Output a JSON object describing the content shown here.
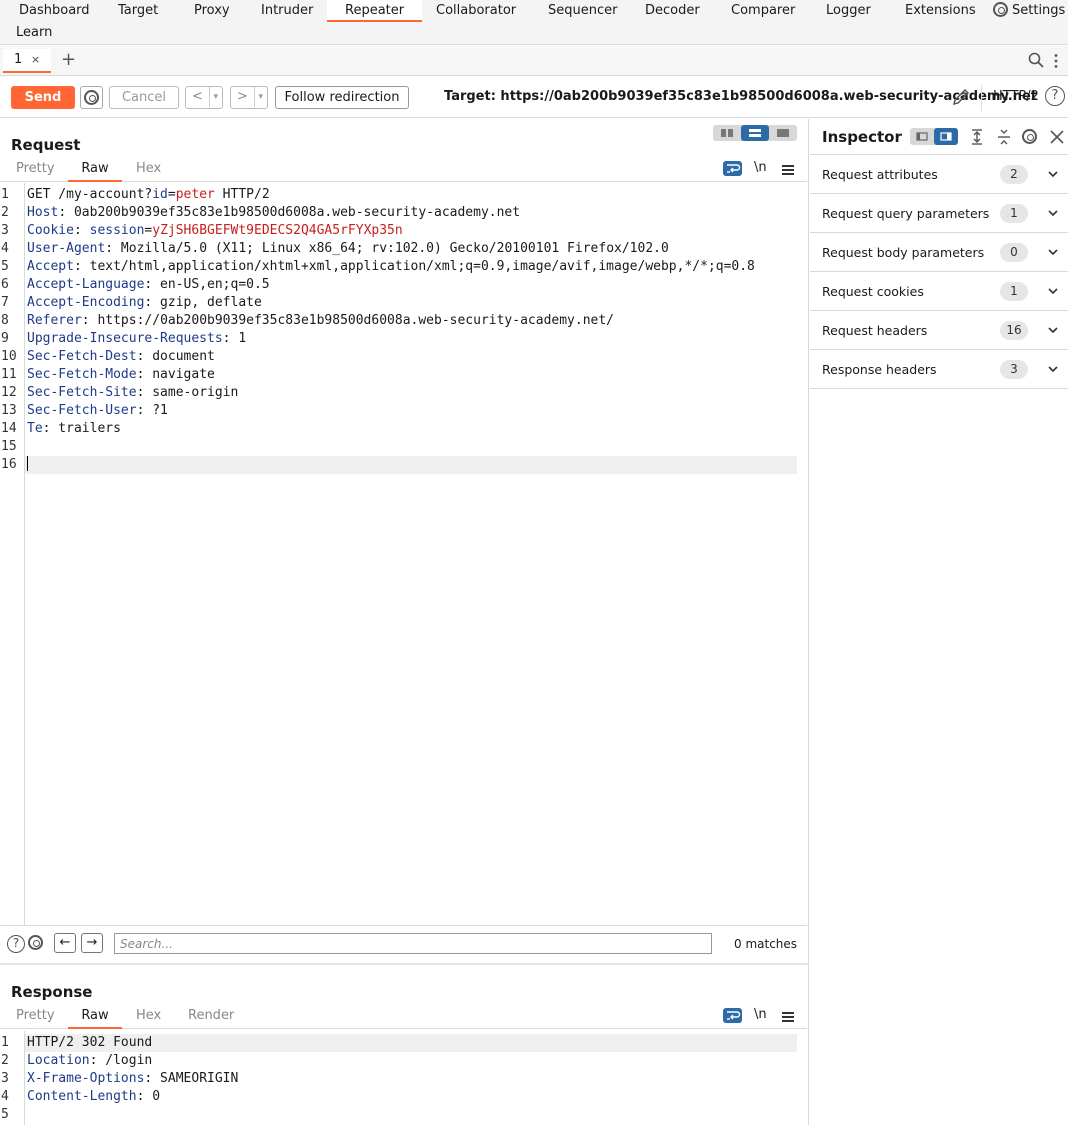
{
  "menu": {
    "items": [
      "Dashboard",
      "Target",
      "Proxy",
      "Intruder",
      "Repeater",
      "Collaborator",
      "Sequencer",
      "Decoder",
      "Comparer",
      "Logger",
      "Extensions"
    ],
    "settings": "Settings",
    "learn": "Learn",
    "active": "Repeater"
  },
  "tabs": {
    "items": [
      {
        "label": "1",
        "close": "×"
      }
    ],
    "add": "+"
  },
  "toolbar": {
    "send": "Send",
    "cancel": "Cancel",
    "back": "<",
    "forward": ">",
    "dropdown": "▾",
    "follow": "Follow redirection",
    "target": "Target: https://0ab200b9039ef35c83e1b98500d6008a.web-security-academy.net",
    "protocol": "HTTP/2",
    "help": "?"
  },
  "request": {
    "title": "Request",
    "subtabs": [
      "Pretty",
      "Raw",
      "Hex"
    ],
    "active_subtab": "Raw",
    "newline_toggle": "\\n",
    "lines": [
      {
        "n": "1",
        "parts": [
          {
            "t": "GET /my-account?",
            "c": ""
          },
          {
            "t": "id",
            "c": "k"
          },
          {
            "t": "=",
            "c": ""
          },
          {
            "t": "peter",
            "c": "v"
          },
          {
            "t": " HTTP/2",
            "c": ""
          }
        ]
      },
      {
        "n": "2",
        "parts": [
          {
            "t": "Host",
            "c": "k"
          },
          {
            "t": ": 0ab200b9039ef35c83e1b98500d6008a.web-security-academy.net",
            "c": ""
          }
        ]
      },
      {
        "n": "3",
        "parts": [
          {
            "t": "Cookie",
            "c": "k"
          },
          {
            "t": ": ",
            "c": ""
          },
          {
            "t": "session",
            "c": "k"
          },
          {
            "t": "=",
            "c": ""
          },
          {
            "t": "yZjSH6BGEFWt9EDECS2Q4GA5rFYXp35n",
            "c": "v"
          }
        ]
      },
      {
        "n": "4",
        "parts": [
          {
            "t": "User-Agent",
            "c": "k"
          },
          {
            "t": ": Mozilla/5.0 (X11; Linux x86_64; rv:102.0) Gecko/20100101 Firefox/102.0",
            "c": ""
          }
        ]
      },
      {
        "n": "5",
        "parts": [
          {
            "t": "Accept",
            "c": "k"
          },
          {
            "t": ": text/html,application/xhtml+xml,application/xml;q=0.9,image/avif,image/webp,*/*;q=0.8",
            "c": ""
          }
        ]
      },
      {
        "n": "6",
        "parts": [
          {
            "t": "Accept-Language",
            "c": "k"
          },
          {
            "t": ": en-US,en;q=0.5",
            "c": ""
          }
        ]
      },
      {
        "n": "7",
        "parts": [
          {
            "t": "Accept-Encoding",
            "c": "k"
          },
          {
            "t": ": gzip, deflate",
            "c": ""
          }
        ]
      },
      {
        "n": "8",
        "parts": [
          {
            "t": "Referer",
            "c": "k"
          },
          {
            "t": ": https://0ab200b9039ef35c83e1b98500d6008a.web-security-academy.net/",
            "c": ""
          }
        ]
      },
      {
        "n": "9",
        "parts": [
          {
            "t": "Upgrade-Insecure-Requests",
            "c": "k"
          },
          {
            "t": ": 1",
            "c": ""
          }
        ]
      },
      {
        "n": "10",
        "parts": [
          {
            "t": "Sec-Fetch-Dest",
            "c": "k"
          },
          {
            "t": ": document",
            "c": ""
          }
        ]
      },
      {
        "n": "11",
        "parts": [
          {
            "t": "Sec-Fetch-Mode",
            "c": "k"
          },
          {
            "t": ": navigate",
            "c": ""
          }
        ]
      },
      {
        "n": "12",
        "parts": [
          {
            "t": "Sec-Fetch-Site",
            "c": "k"
          },
          {
            "t": ": same-origin",
            "c": ""
          }
        ]
      },
      {
        "n": "13",
        "parts": [
          {
            "t": "Sec-Fetch-User",
            "c": "k"
          },
          {
            "t": ": ?1",
            "c": ""
          }
        ]
      },
      {
        "n": "14",
        "parts": [
          {
            "t": "Te",
            "c": "k"
          },
          {
            "t": ": trailers",
            "c": ""
          }
        ]
      },
      {
        "n": "15",
        "parts": []
      },
      {
        "n": "16",
        "parts": [],
        "current": true
      }
    ]
  },
  "search": {
    "placeholder": "Search...",
    "value": "",
    "matches": "0 matches",
    "prev": "←",
    "next": "→"
  },
  "response": {
    "title": "Response",
    "subtabs": [
      "Pretty",
      "Raw",
      "Hex",
      "Render"
    ],
    "active_subtab": "Raw",
    "newline_toggle": "\\n",
    "lines": [
      {
        "n": "1",
        "parts": [
          {
            "t": "HTTP/2 302 Found",
            "c": ""
          }
        ],
        "current": true
      },
      {
        "n": "2",
        "parts": [
          {
            "t": "Location",
            "c": "k"
          },
          {
            "t": ": /login",
            "c": ""
          }
        ]
      },
      {
        "n": "3",
        "parts": [
          {
            "t": "X-Frame-Options",
            "c": "k"
          },
          {
            "t": ": SAMEORIGIN",
            "c": ""
          }
        ]
      },
      {
        "n": "4",
        "parts": [
          {
            "t": "Content-Length",
            "c": "k"
          },
          {
            "t": ": 0",
            "c": ""
          }
        ]
      },
      {
        "n": "5",
        "parts": []
      }
    ]
  },
  "inspector": {
    "title": "Inspector",
    "sections": [
      {
        "label": "Request attributes",
        "count": "2"
      },
      {
        "label": "Request query parameters",
        "count": "1"
      },
      {
        "label": "Request body parameters",
        "count": "0"
      },
      {
        "label": "Request cookies",
        "count": "1"
      },
      {
        "label": "Request headers",
        "count": "16"
      },
      {
        "label": "Response headers",
        "count": "3"
      }
    ]
  },
  "colors": {
    "accent": "#ff6633",
    "toggle_active": "#2c6aa8",
    "header_key": "#1f3a8a",
    "param_value": "#c81e1e"
  }
}
